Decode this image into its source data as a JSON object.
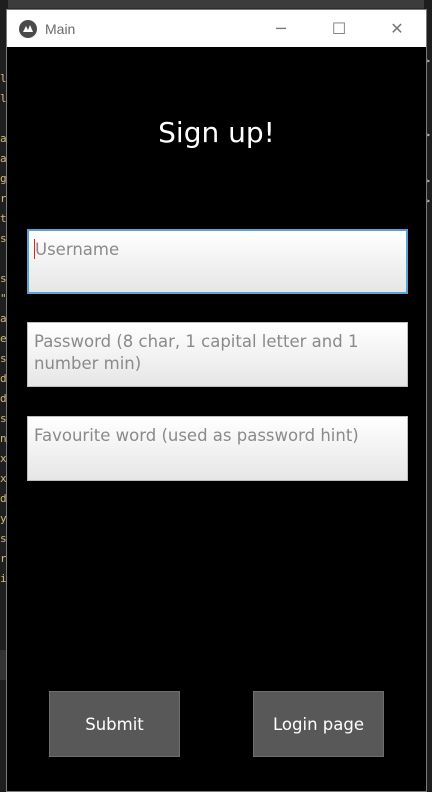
{
  "window": {
    "title": "Main",
    "controls": {
      "minimize": "─",
      "maximize": "☐",
      "close": "✕"
    }
  },
  "form": {
    "heading": "Sign up!",
    "username_placeholder": "Username",
    "password_placeholder": "Password (8 char, 1 capital letter and 1 number min)",
    "hint_placeholder": "Favourite word (used as password hint)"
  },
  "buttons": {
    "submit_label": "Submit",
    "login_label": "Login page"
  },
  "colors": {
    "window_bg": "#000000",
    "button_bg": "#585858",
    "focus_border": "#5aa3d6"
  }
}
